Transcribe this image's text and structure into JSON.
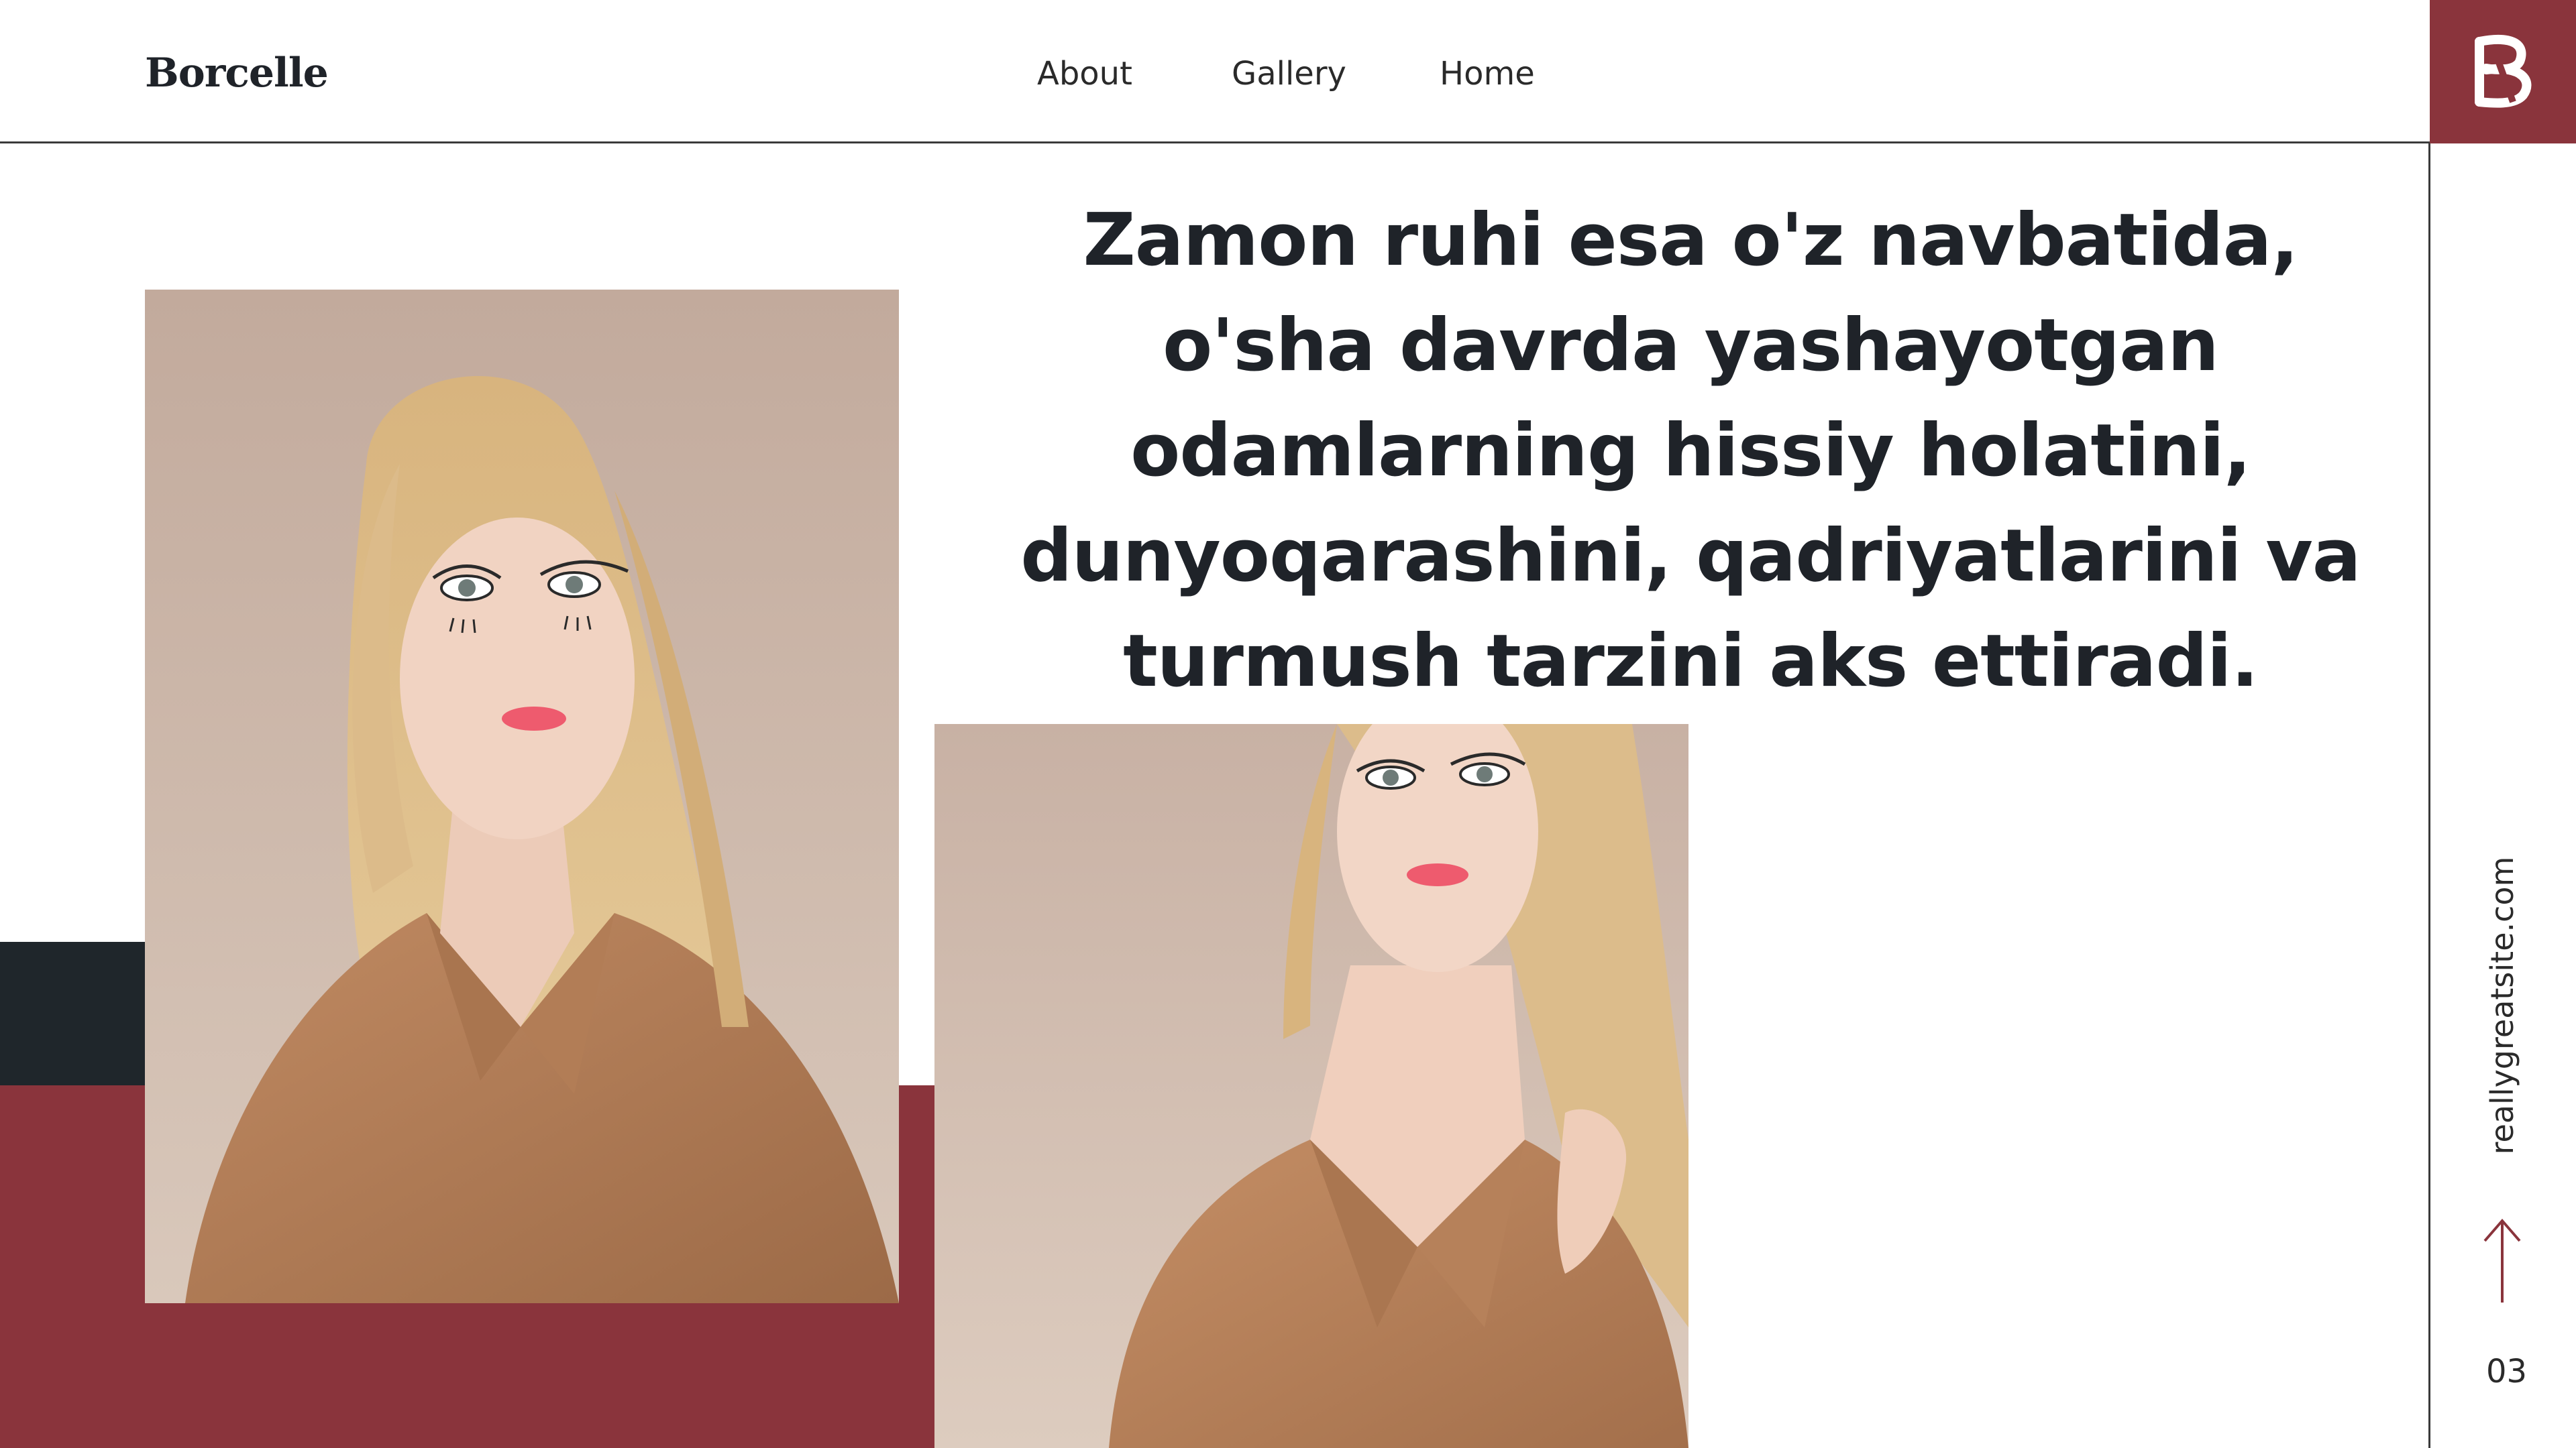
{
  "header": {
    "brand": "Borcelle",
    "nav": [
      {
        "label": "About"
      },
      {
        "label": "Gallery"
      },
      {
        "label": "Home"
      }
    ],
    "logo_icon": "borcelle-b-logo-icon"
  },
  "main": {
    "headline": "Zamon ruhi esa o'z navbatida, o'sha davrda yashayotgan odamlarning hissiy holatini, dunyoqarashini, qadriyatlarini va turmush tarzini aks ettiradi."
  },
  "sidebar": {
    "website": "reallygreatsite.com",
    "page_number": "03",
    "arrow_icon": "arrow-up-icon"
  },
  "colors": {
    "accent": "#8a343c",
    "dark": "#1f262b",
    "photo_bg": "#c9b2a6",
    "coat": "#b9825d"
  }
}
